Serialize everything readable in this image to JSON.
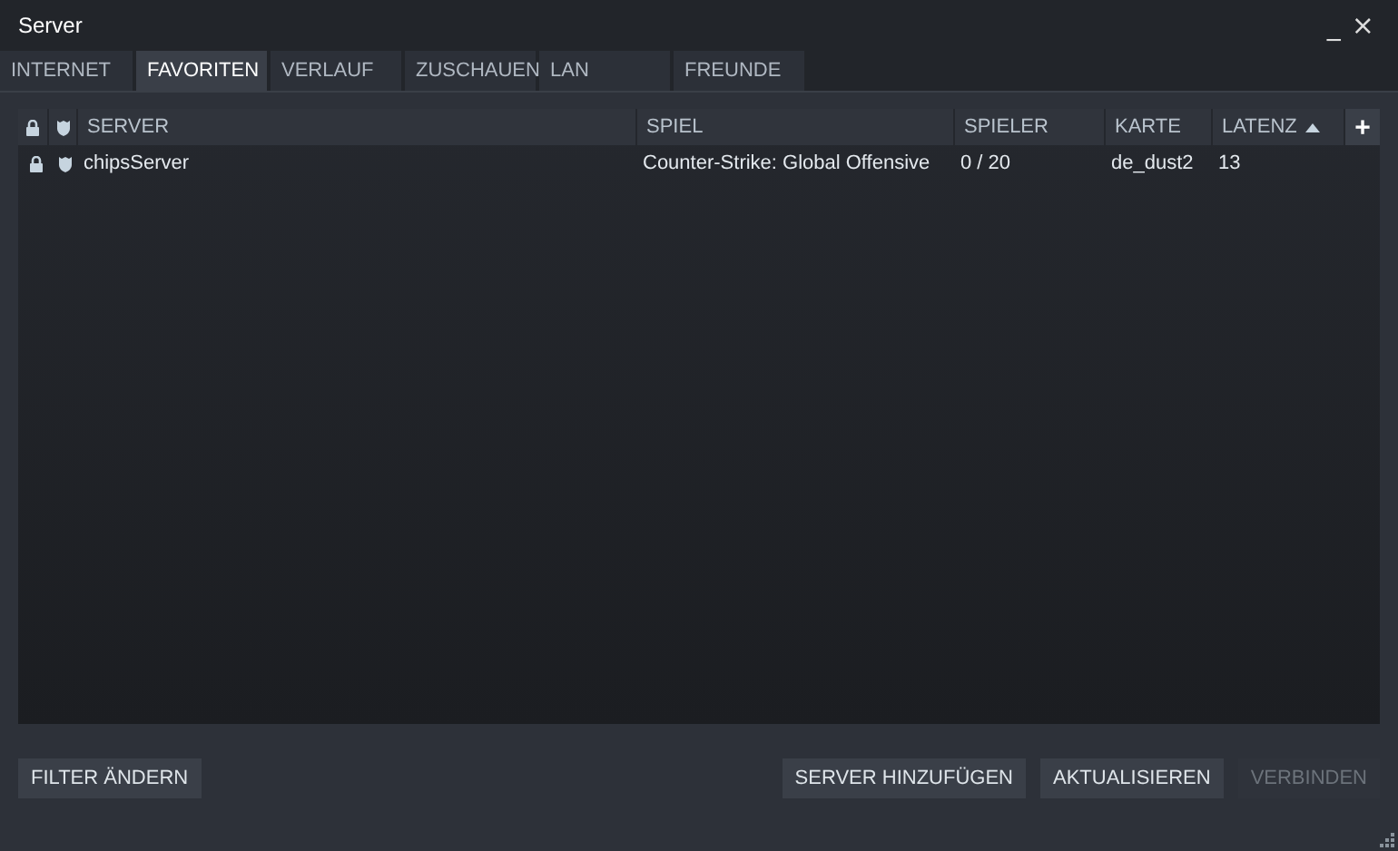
{
  "window": {
    "title": "Server",
    "controls": [
      "_",
      "×"
    ]
  },
  "tabs": [
    {
      "label": "INTERNET",
      "selected": false
    },
    {
      "label": "FAVORITEN",
      "selected": true
    },
    {
      "label": "VERLAUF",
      "selected": false
    },
    {
      "label": "ZUSCHAUEN",
      "selected": false
    },
    {
      "label": "LAN",
      "selected": false
    },
    {
      "label": "FREUNDE",
      "selected": false
    }
  ],
  "table": {
    "header_icons": [
      {
        "kind": "lock"
      },
      {
        "kind": "shield"
      }
    ],
    "columns": [
      {
        "label": "SERVER",
        "sorted_ascending": false
      },
      {
        "label": "SPIEL",
        "sorted_ascending": false
      },
      {
        "label": "SPIELER",
        "sorted_ascending": false
      },
      {
        "label": "KARTE",
        "sorted_ascending": false
      },
      {
        "label": "LATENZ",
        "sorted_ascending": true
      }
    ],
    "add_column_button": "+",
    "rows": [
      {
        "locked": true,
        "secure": true,
        "cells": [
          "chipsServer",
          "Counter-Strike: Global Offensive",
          "0 / 20",
          "de_dust2",
          "13"
        ]
      }
    ]
  },
  "buttons_left": [
    {
      "label": "FILTER ÄNDERN",
      "disabled": false
    }
  ],
  "buttons_right": [
    {
      "label": "SERVER HINZUFÜGEN",
      "disabled": false
    },
    {
      "label": "AKTUALISIEREN",
      "disabled": false
    },
    {
      "label": "VERBINDEN",
      "disabled": true
    }
  ]
}
